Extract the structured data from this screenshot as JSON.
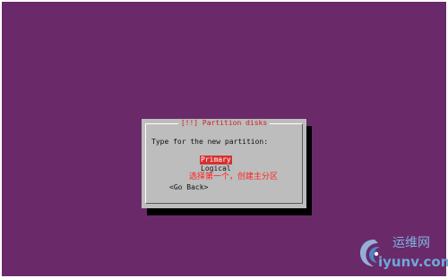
{
  "dialog": {
    "title": "[!!] Partition disks",
    "prompt": "Type for the new partition:",
    "options": [
      "Primary",
      "Logical"
    ],
    "selected_option": "Primary",
    "go_back_label": "<Go Back>"
  },
  "annotation": {
    "text": "选择第一个，创建主分区"
  },
  "watermark": {
    "name_cn": "运维网",
    "url": "iyunv.com"
  },
  "colors": {
    "desktop_background": "#6a2a6a",
    "dialog_background": "#bdbdbd",
    "selection_highlight": "#d63030",
    "title_text": "#cc2222",
    "annotation_text": "#ff2020"
  },
  "icons": {
    "watermark_logo": "swirl-logo-icon"
  }
}
